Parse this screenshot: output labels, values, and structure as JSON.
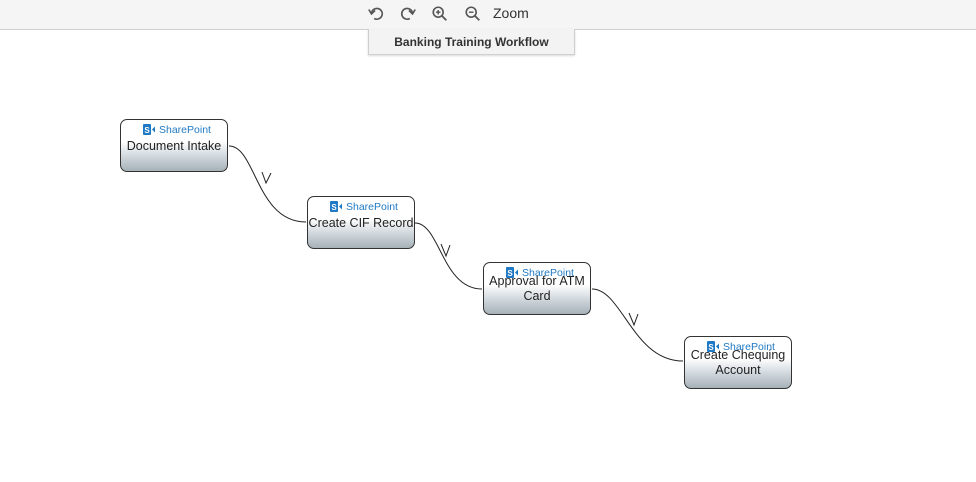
{
  "toolbar": {
    "icons": [
      "undo-icon",
      "redo-icon",
      "zoom-in-icon",
      "zoom-out-icon"
    ],
    "zoom_label": "Zoom"
  },
  "workflow_title": "Banking Training Workflow",
  "nodes": [
    {
      "id": "document-intake",
      "brand": "SharePoint",
      "label": "Document Intake"
    },
    {
      "id": "create-cif-record",
      "brand": "SharePoint",
      "label": "Create CIF Record"
    },
    {
      "id": "approval-atm-card",
      "brand": "SharePoint",
      "label": "Approval for ATM Card"
    },
    {
      "id": "create-chequing-account",
      "brand": "SharePoint",
      "label": "Create Chequing Account"
    }
  ],
  "colors": {
    "sharepoint_blue": "#1f79c4",
    "node_border": "#333333",
    "toolbar_bg": "#f5f5f5"
  }
}
